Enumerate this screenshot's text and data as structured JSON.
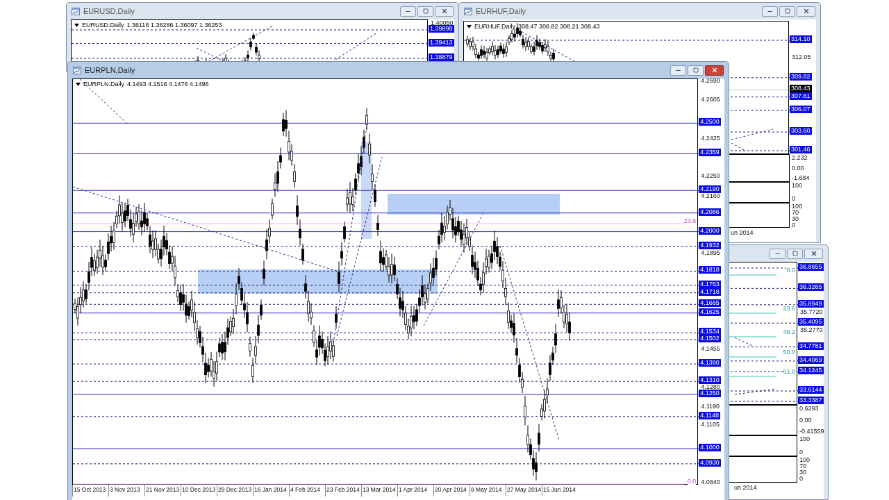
{
  "top_left_window": {
    "title": "EURUSD,Daily",
    "active": false,
    "symbol": "EURUSD.Daily",
    "quote": "1.36116 1.36286 1.36097 1.36253",
    "ticks": [
      "1.40050"
    ],
    "levels": [
      {
        "price": "1.39898",
        "kind": "dashed"
      },
      {
        "price": "1.39413",
        "kind": "dashed"
      },
      {
        "price": "1.38879",
        "kind": "dashed"
      }
    ]
  },
  "top_right_window": {
    "title": "EURHUF,Daily",
    "active": false,
    "symbol": "EURHUF.Daily",
    "quote": "308.47 308.82 308.21 308.43",
    "ticks": [
      "312.05"
    ],
    "levels": [
      {
        "price": "314.10",
        "kind": "dashed"
      },
      {
        "price": "309.82",
        "kind": "dashed"
      },
      {
        "price": "308.43",
        "kind": "bid"
      },
      {
        "price": "307.61",
        "kind": "dashed"
      },
      {
        "price": "306.07",
        "kind": "dashed"
      },
      {
        "price": "303.60",
        "kind": "dashed"
      },
      {
        "price": "301.46",
        "kind": "dashed"
      }
    ],
    "indicator_panes": [
      {
        "labels": [
          "2.232",
          "0.00",
          "-1.684"
        ]
      },
      {
        "labels": [
          "100",
          "0"
        ]
      },
      {
        "labels": [
          "100",
          "70",
          "30",
          "0"
        ]
      }
    ],
    "date_label": "un 2014"
  },
  "right_window": {
    "active": false,
    "ticks": [
      "35.7720",
      "35.2770"
    ],
    "levels": [
      {
        "price": "36.8655",
        "kind": "dashed"
      },
      {
        "price": "36.3265",
        "kind": "dashed"
      },
      {
        "price": "35.8949",
        "kind": "dashed"
      },
      {
        "price": "35.4095",
        "kind": "dashed"
      },
      {
        "price": "34.7781",
        "kind": "dashed"
      },
      {
        "price": "34.4069",
        "kind": "dashed"
      },
      {
        "price": "34.1245",
        "kind": "dashed"
      },
      {
        "price": "33.6144",
        "kind": "dashed"
      },
      {
        "price": "33.3387",
        "kind": "dashed"
      }
    ],
    "fib_labels": [
      "0.0",
      "23.6",
      "38.2",
      "50.0",
      "61.8"
    ],
    "indicator_panes": [
      {
        "labels": [
          "0.6293",
          "0.00",
          "-0.41559"
        ]
      },
      {
        "labels": [
          "100",
          "0"
        ]
      },
      {
        "labels": [
          "100",
          "70",
          "30",
          "0"
        ]
      }
    ],
    "date_label": "un 2014"
  },
  "main_window": {
    "title": "EURPLN,Daily",
    "active": true,
    "symbol": "EURPLN.Daily",
    "quote": "4.1493 4.1516 4.1476 4.1496",
    "ticks": [
      "4.2690",
      "4.2605",
      "4.2425",
      "4.2250",
      "4.2160",
      "4.1895",
      "4.1455",
      "4.1280",
      "4.1190",
      "4.1105",
      "4.0840"
    ],
    "levels": [
      {
        "price": "4.2500",
        "kind": "solid"
      },
      {
        "price": "4.2359",
        "kind": "solid"
      },
      {
        "price": "4.2190",
        "kind": "solid"
      },
      {
        "price": "4.2086",
        "kind": "solid"
      },
      {
        "price": "4.2000",
        "kind": "solid"
      },
      {
        "price": "4.1932",
        "kind": "dashed"
      },
      {
        "price": "4.1818",
        "kind": "dashed"
      },
      {
        "price": "4.1753",
        "kind": "dashed"
      },
      {
        "price": "4.1718",
        "kind": "dashed"
      },
      {
        "price": "4.1665",
        "kind": "dashed"
      },
      {
        "price": "4.1625",
        "kind": "solid"
      },
      {
        "price": "4.1534",
        "kind": "dashed"
      },
      {
        "price": "4.1502",
        "kind": "dashed"
      },
      {
        "price": "4.1390",
        "kind": "dashed"
      },
      {
        "price": "4.1310",
        "kind": "dashed"
      },
      {
        "price": "4.1250",
        "kind": "solid"
      },
      {
        "price": "4.1148",
        "kind": "dashed"
      },
      {
        "price": "4.1000",
        "kind": "solid"
      },
      {
        "price": "4.0930",
        "kind": "dashed"
      }
    ],
    "fib_labels": [
      "23.6",
      "0.0"
    ],
    "dates": [
      "15 Oct 2013",
      "3 Nov 2013",
      "21 Nov 2013",
      "10 Dec 2013",
      "29 Dec 2013",
      "16 Jan 2014",
      "4 Feb 2014",
      "23 Feb 2014",
      "13 Mar 2014",
      "1 Apr 2014",
      "20 Apr 2014",
      "8 May 2014",
      "27 May 2014",
      "15 Jun 2014"
    ]
  }
}
